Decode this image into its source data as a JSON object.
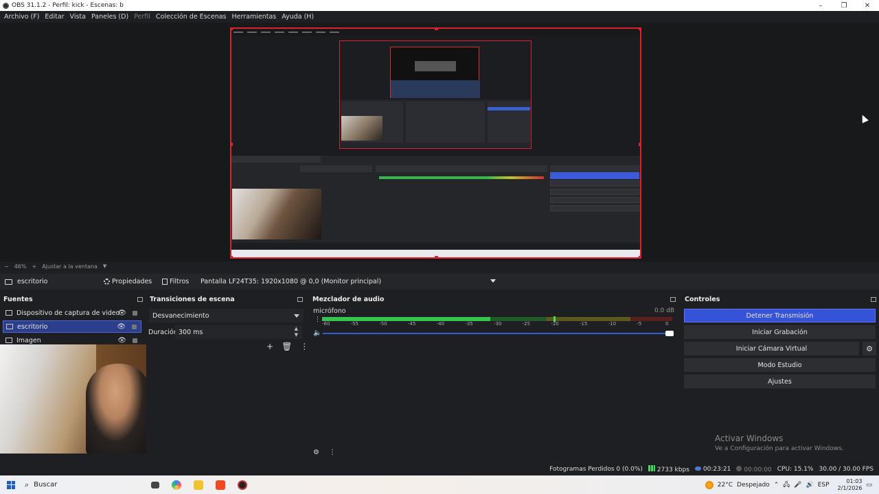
{
  "window": {
    "title": "OBS 31.1.2 - Perfil: kick - Escenas: b",
    "controls": [
      "–",
      "❐",
      "✕"
    ]
  },
  "menu": {
    "items": [
      "Archivo (F)",
      "Editar",
      "Vista",
      "Paneles (D)",
      "Perfil",
      "Colección de Escenas",
      "Herramientas",
      "Ayuda (H)"
    ]
  },
  "zoom": {
    "level": "46%",
    "fit_label": "Ajustar a la ventana"
  },
  "context": {
    "source": "escritorio",
    "properties": "Propiedades",
    "filters": "Filtros",
    "display_label": "Pantalla",
    "display_value": "LF24T35: 1920x1080 @ 0,0 (Monitor principal)"
  },
  "docks": {
    "sources": {
      "title": "Fuentes",
      "items": [
        {
          "label": "Dispositivo de captura de video",
          "selected": false
        },
        {
          "label": "escritorio",
          "selected": true
        },
        {
          "label": "Imagen",
          "selected": false
        }
      ]
    },
    "transitions": {
      "title": "Transiciones de escena",
      "type": "Desvanecimiento",
      "duration_label": "Duración",
      "duration_value": "300 ms"
    },
    "mixer": {
      "title": "Mezclador de audio",
      "channel": "micrófono",
      "db": "0.0 dB",
      "level_fraction": 0.48,
      "peak_fraction": 0.66,
      "volume_fraction": 1.0,
      "scale": [
        "-60",
        "-55",
        "-50",
        "-45",
        "-40",
        "-35",
        "-30",
        "-25",
        "-20",
        "-15",
        "-10",
        "-5",
        "0"
      ]
    },
    "controls": {
      "title": "Controles",
      "buttons": [
        "Detener Transmisión",
        "Iniciar Grabación",
        "Iniciar Cámara Virtual",
        "Modo Estudio",
        "Ajustes"
      ]
    }
  },
  "watermark": {
    "line1": "Activar Windows",
    "line2": "Ve a Configuración para activar Windows."
  },
  "status": {
    "dropped": "Fotogramas Perdidos 0 (0.0%)",
    "bitrate": "2733 kbps",
    "stream_time": "00:23:21",
    "rec_time": "00:00:00",
    "cpu": "CPU: 15.1%",
    "fps": "30.00 / 30.00 FPS"
  },
  "taskbar": {
    "search": "Buscar",
    "weather": "22°C",
    "weather_desc": "Despejado",
    "lang": "ESP",
    "time": "01:03",
    "date": "2/1/2026"
  },
  "colors": {
    "accent": "#3652d6",
    "selection": "#e0202c",
    "meter": "#36c44e"
  }
}
